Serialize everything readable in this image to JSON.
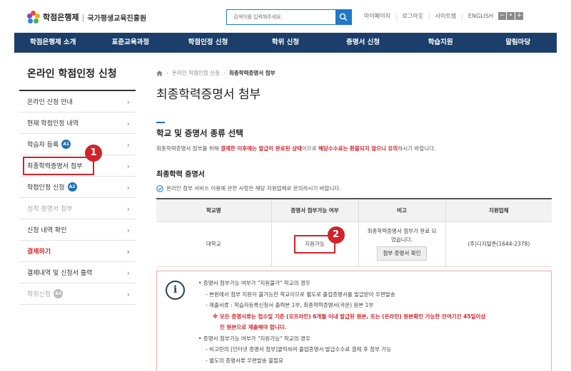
{
  "header": {
    "brand": "학점은행제",
    "separator": "|",
    "org": "국가평생교육진흥원",
    "search_placeholder": "검색어를 입력해주세요.",
    "util_links": [
      "마이페이지",
      "로그아웃",
      "사이트맵",
      "ENGLISH"
    ],
    "zoom": {
      "minus": "−",
      "reset": "•",
      "plus": "+"
    },
    "brand_colors": {
      "navy": "#1b3f6a",
      "blue": "#1e6fb8",
      "red": "#d0232b"
    }
  },
  "gnb": [
    "학점은행제 소개",
    "표준교육과정",
    "학점인정 신청",
    "학위 신청",
    "증명서 신청",
    "학습지원",
    "알림마당"
  ],
  "sidebar": {
    "title": "온라인 학점인정 신청",
    "items": [
      {
        "label": "온라인 신청 안내"
      },
      {
        "label": "현재 학점인정 내역"
      },
      {
        "label": "학습자 등록",
        "badge": "A1"
      },
      {
        "label": "최종학력증명서 첨부"
      },
      {
        "label": "학점인정 신청",
        "badge": "A2"
      },
      {
        "label": "성적 증명서 첨부"
      },
      {
        "label": "신청 내역 확인"
      },
      {
        "label": "결제하기"
      },
      {
        "label": "결제내역 및 신청서 출력"
      },
      {
        "label": "학위신청",
        "badge": "A3"
      }
    ],
    "chevron": "›"
  },
  "annotations": {
    "n1": "1",
    "n2": "2"
  },
  "main": {
    "breadcrumb": [
      "온라인 학점인정 신청",
      "최종학력증명서 첨부"
    ],
    "breadcrumb_sep": "›",
    "page_title": "최종학력증명서 첨부",
    "section_title": "학교 및 증명서 종류 선택",
    "desc": {
      "p1": "최종학력증명서 첨부를 위해 ",
      "em1": "결제한 이후에는 발급이 완료된 상태",
      "p2": "이므로 ",
      "em2": "해당수수료는 환불되지 않으니 유의",
      "p3": "하시기 바랍니다."
    },
    "sub_title": "최종학력 증명서",
    "notice": "온라인 첨부 서비스 이용에 관한 사항은 해당 지원업체로 문의하시기 바랍니다.",
    "table": {
      "headers": [
        "학교명",
        "증명서 첨부가능 여부",
        "비고",
        "지원업체"
      ],
      "row": {
        "school": "대학교",
        "availability": "지원가능",
        "note_line1": "최종학력증명서 첨부가 완료 되",
        "note_line2": "었습니다.",
        "button": "첨부 증명서 확인",
        "vendor": "(주)디지털존(1644-2378)"
      }
    },
    "info": {
      "icon": "i",
      "lines": [
        "• 증명서 첨부가능 여부가 \"지원불가\" 학교의 경우",
        "- 본원에서 첨부 지원이 불가능한 학교이므로 별도로 졸업증명서를 발급받아 우편발송",
        "- 제출서류 : 학습자등록신청서 출력본 1부, 최종학력증명서(국문) 원본 1부",
        "※ 모든 증명서류는 접수일 기준 (오프라인) 6개월 이내 발급된 원본, 또는 (온라인) 원본확인 가능한 잔여기간 45일이상",
        "인 원본으로 제출해야 합니다.",
        "• 증명서 첨부가능 여부가 \"지원가능\" 학교의 경우",
        "- 비고란의 [인터넷 증명서 첨부]클릭하여 졸업증명서 발급수수료 결제 후 첨부 가능",
        "- 별도의 증명서류 우편발송 불필요"
      ]
    }
  }
}
